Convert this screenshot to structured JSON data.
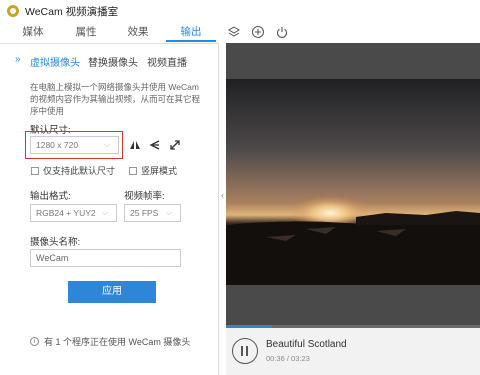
{
  "app": {
    "title": "WeCam 视频演播室"
  },
  "tabs": [
    {
      "label": "媒体"
    },
    {
      "label": "属性"
    },
    {
      "label": "效果"
    },
    {
      "label": "输出"
    }
  ],
  "toolbar_icons": [
    "layers-icon",
    "add-circle-icon",
    "power-icon"
  ],
  "output": {
    "subtabs": [
      {
        "label": "虚拟摄像头"
      },
      {
        "label": "替换摄像头"
      },
      {
        "label": "视频直播"
      }
    ],
    "description": "在电脑上模拟一个网络摄像头并使用 WeCam 的视频内容作为其输出视频，从而可在其它程序中使用",
    "size_label": "默认尺寸:",
    "size_value": "1280 x 720",
    "only_default_size": "仅支持此默认尺寸",
    "mirror_mode": "竖屏模式",
    "format_label": "输出格式:",
    "format_value": "RGB24 + YUY2",
    "fps_label": "视频帧率:",
    "fps_value": "25 FPS",
    "camera_name_label": "摄像头名称:",
    "camera_name_value": "WeCam",
    "apply_label": "应用",
    "status": "有 1 个程序正在使用 WeCam 摄像头"
  },
  "player": {
    "track_name": "Beautiful Scotland",
    "time": "00:36 / 03:23",
    "progress": 0.18
  },
  "colors": {
    "accent": "#2a8ae0",
    "highlight": "#d9332b"
  }
}
